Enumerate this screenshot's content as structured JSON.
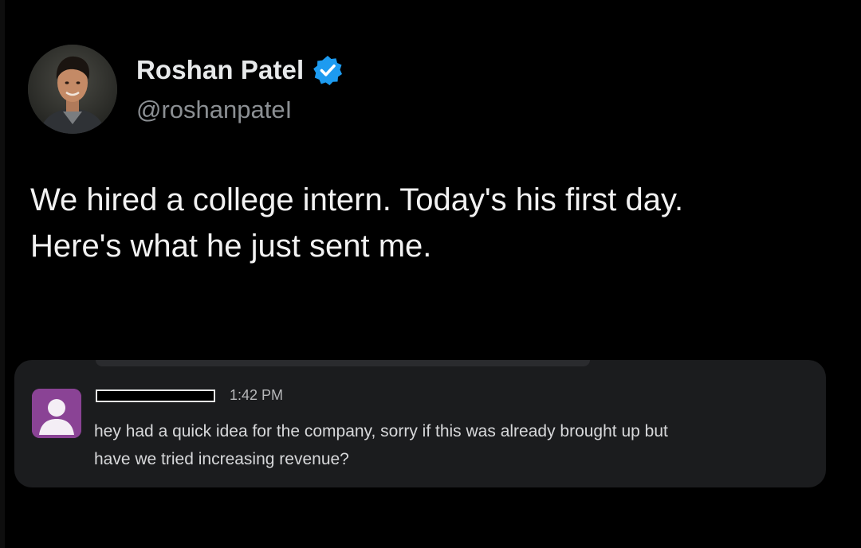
{
  "tweet": {
    "author": {
      "display_name": "Roshan Patel",
      "handle": "@roshanpateI",
      "verified": true,
      "avatar_icon": "profile-photo",
      "verified_icon": "verified-badge-icon",
      "verified_color": "#1d9bf0"
    },
    "text_lines": [
      "We hired a college intern. Today's his first day.",
      "Here's what he just sent me."
    ],
    "embedded_message": {
      "sender_redacted": true,
      "avatar_icon": "default-user-icon",
      "avatar_color": "#8a4395",
      "time": "1:42 PM",
      "body_lines": [
        "hey had a quick idea for the company, sorry if this was already brought up but",
        "have we tried increasing revenue?"
      ]
    }
  },
  "colors": {
    "background": "#000000",
    "card": "#1b1c1e",
    "text": "#e7e9ea",
    "secondary_text": "#8b8f93"
  }
}
